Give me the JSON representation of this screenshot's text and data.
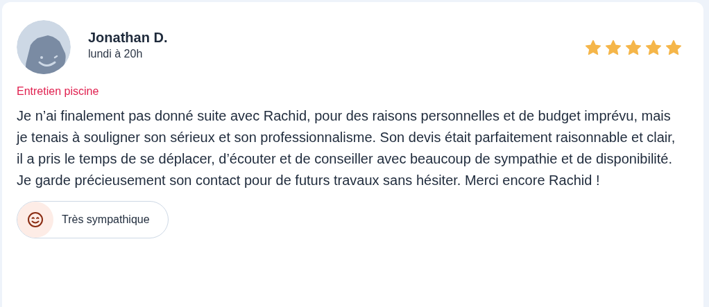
{
  "review": {
    "author": "Jonathan D.",
    "time": "lundi à 20h",
    "stars": 5,
    "service": "Entretien piscine",
    "text": "Je n’ai finalement pas donné suite avec Rachid, pour des raisons personnelles et de budget imprévu, mais je tenais à souligner son sérieux et son professionnalisme. Son devis était parfaitement raisonnable et clair, il a pris le temps de se déplacer, d’écouter et de conseiller avec beaucoup de sympathie et de disponibilité. Je garde précieusement son contact pour de futurs travaux sans hésiter. Merci encore Rachid !",
    "tags": [
      {
        "label": "Très sympathique"
      }
    ]
  }
}
